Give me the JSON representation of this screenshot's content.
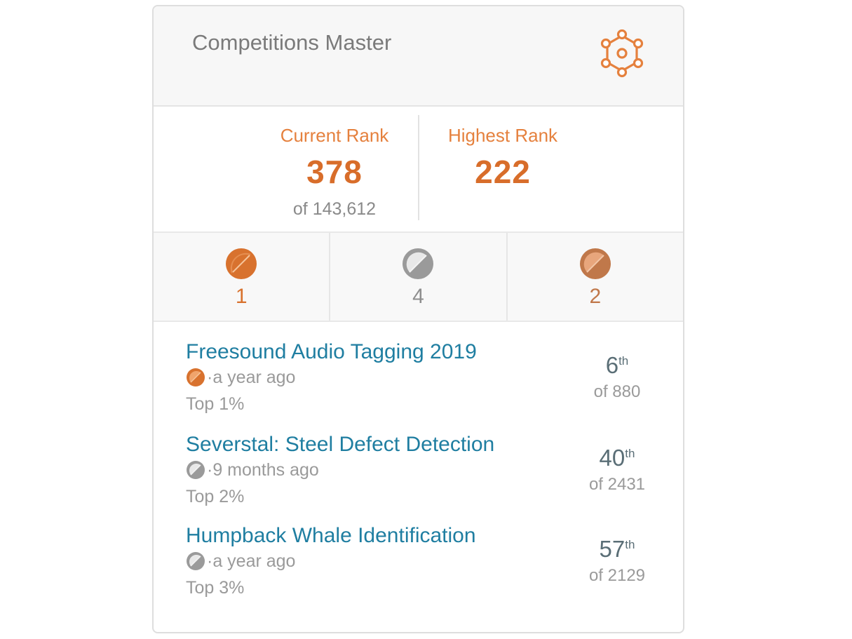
{
  "profile": {
    "tier_name": "Competitions Master",
    "tier_icon": "competitions-network-icon"
  },
  "ranks": {
    "current_label": "Current Rank",
    "current_value": "378",
    "current_of": "of 143,612",
    "highest_label": "Highest Rank",
    "highest_value": "222"
  },
  "medals": [
    {
      "type": "gold",
      "count": "1",
      "color": "#d8722e"
    },
    {
      "type": "silver",
      "count": "4",
      "color": "#8e8e8e"
    },
    {
      "type": "bronze",
      "count": "2",
      "color": "#c0784a"
    }
  ],
  "competitions": [
    {
      "title": "Freesound Audio Tagging 2019",
      "medal": "gold",
      "age": "·a year ago",
      "top": "Top 1%",
      "place": "6",
      "suffix": "th",
      "of": "of 880"
    },
    {
      "title": "Severstal: Steel Defect Detection",
      "medal": "silver",
      "age": "·9 months ago",
      "top": "Top 2%",
      "place": "40",
      "suffix": "th",
      "of": "of 2431"
    },
    {
      "title": "Humpback Whale Identification",
      "medal": "silver",
      "age": "·a year ago",
      "top": "Top 3%",
      "place": "57",
      "suffix": "th",
      "of": "of 2129"
    }
  ],
  "colors": {
    "accent": "#e5813e",
    "link": "#1f7ea1"
  }
}
